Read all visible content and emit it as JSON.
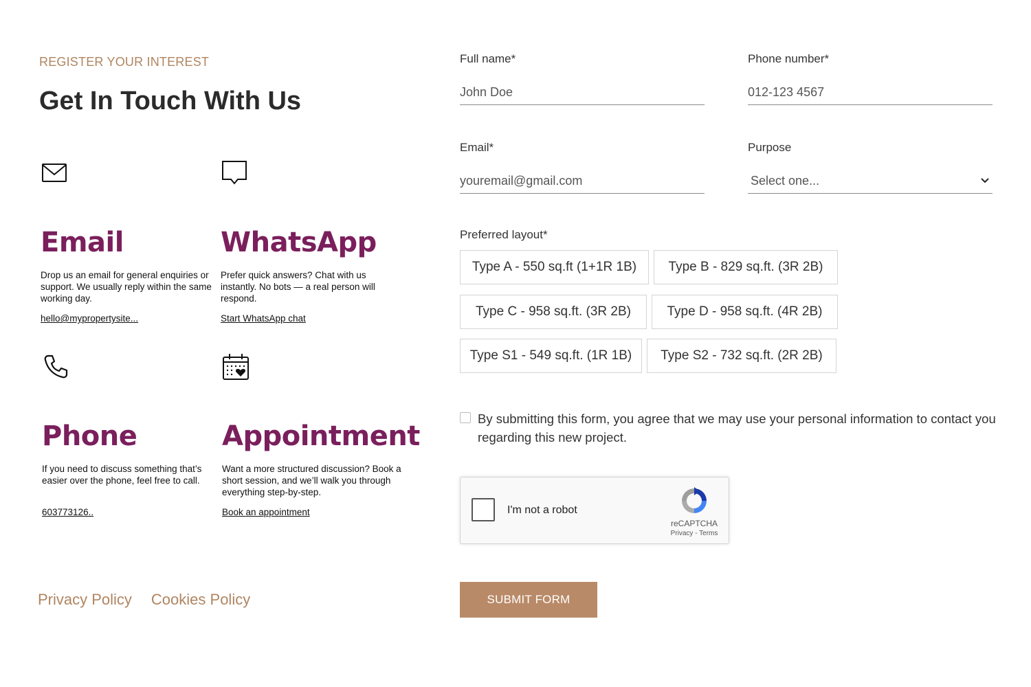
{
  "intro": {
    "eyebrow": "REGISTER YOUR INTEREST",
    "headline": "Get In Touch With Us"
  },
  "contact_cards": [
    {
      "icon": "mail-icon",
      "title": "Email",
      "description": "Drop us an email for general enquiries or support. We usually reply within the same working day.",
      "link": "hello@mypropertysite..."
    },
    {
      "icon": "chat-bubble-icon",
      "title": "WhatsApp",
      "description": "Prefer quick answers? Chat with us instantly. No bots — a real person will respond.",
      "link": "Start WhatsApp chat"
    },
    {
      "icon": "phone-icon",
      "title": "Phone",
      "description": "If you need to discuss something that’s easier over the phone, feel free to call.",
      "link": "603773126.."
    },
    {
      "icon": "calendar-heart-icon",
      "title": "Appointment",
      "description": "Want a more structured discussion? Book a short session, and we’ll walk you through everything step-by-step.",
      "link": "Book an appointment"
    }
  ],
  "footer": {
    "privacy": "Privacy Policy",
    "cookies": "Cookies Policy"
  },
  "form": {
    "full_name": {
      "label": "Full name*",
      "placeholder": "John Doe"
    },
    "phone": {
      "label": "Phone number*",
      "placeholder": "012-123 4567"
    },
    "email": {
      "label": "Email*",
      "placeholder": "youremail@gmail.com"
    },
    "purpose": {
      "label": "Purpose",
      "selected": "Select one..."
    },
    "layout": {
      "label": "Preferred layout*",
      "options": [
        "Type A - 550 sq.ft (1+1R 1B)",
        "Type B - 829 sq.ft. (3R 2B)",
        "Type C - 958 sq.ft. (3R 2B)",
        "Type D - 958 sq.ft. (4R 2B)",
        "Type S1 - 549 sq.ft. (1R 1B)",
        "Type S2 - 732 sq.ft. (2R 2B)"
      ]
    },
    "consent": "By submitting this form, you agree that we may use your personal information to contact you regarding this new project.",
    "captcha": {
      "label": "I'm not a robot",
      "brand": "reCAPTCHA",
      "terms": "Privacy - Terms"
    },
    "submit": "SUBMIT FORM"
  },
  "colors": {
    "accent": "#b08561",
    "title_purple": "#7a1f5c",
    "button": "#b98a68"
  }
}
